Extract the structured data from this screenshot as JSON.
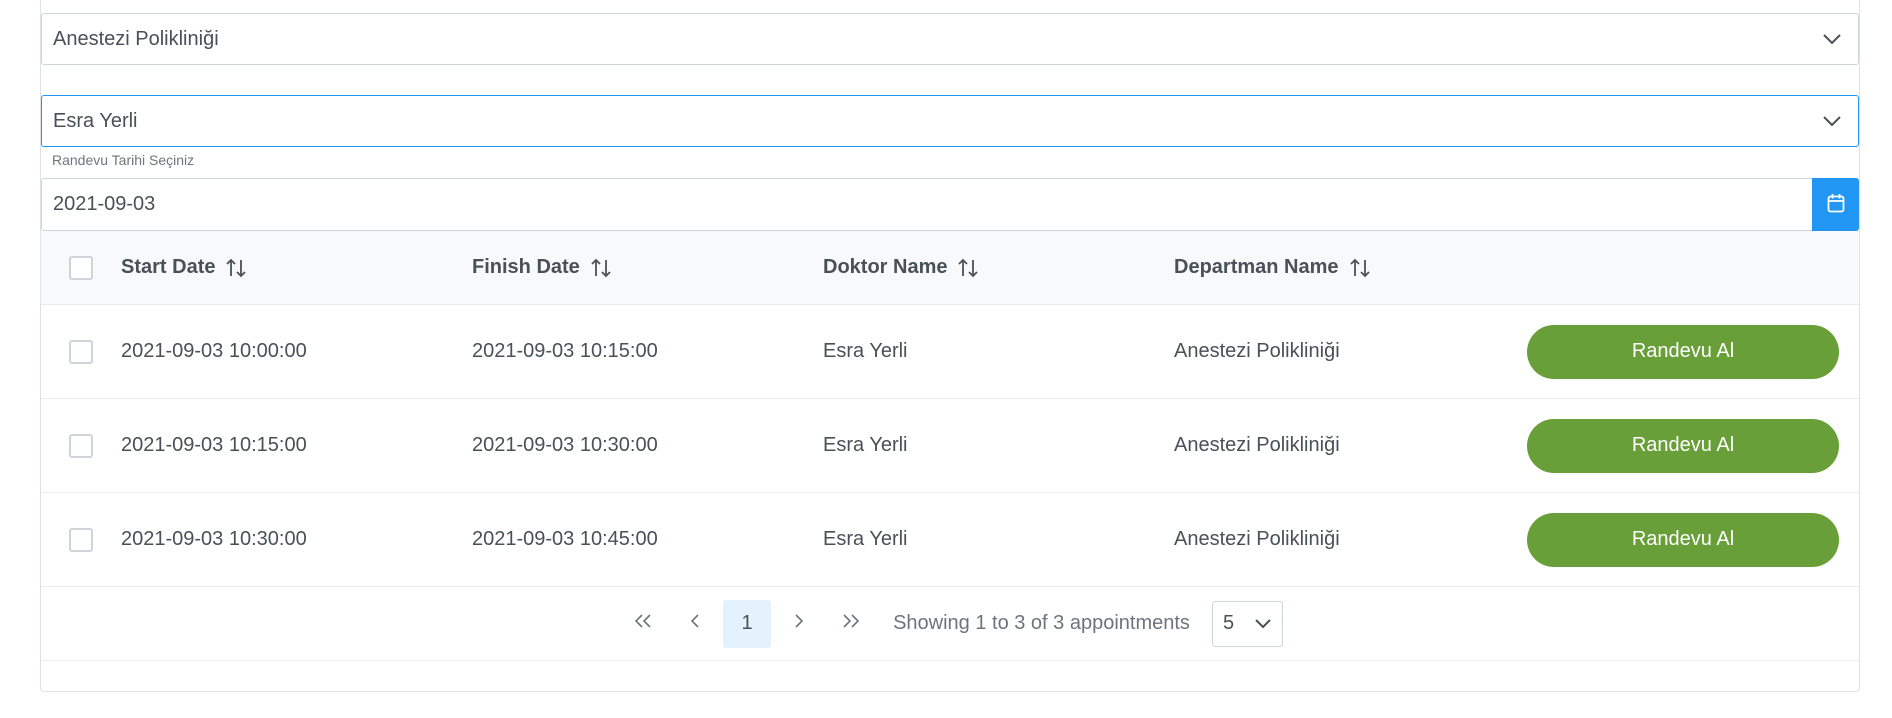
{
  "department_select": {
    "value": "Anestezi Polikliniği"
  },
  "doctor_select": {
    "value": "Esra Yerli"
  },
  "date_picker": {
    "label": "Randevu Tarihi Seçiniz",
    "value": "2021-09-03"
  },
  "table": {
    "columns": [
      "Start Date",
      "Finish Date",
      "Doktor Name",
      "Departman Name"
    ],
    "rows": [
      {
        "start": "2021-09-03 10:00:00",
        "finish": "2021-09-03 10:15:00",
        "doctor": "Esra Yerli",
        "department": "Anestezi Polikliniği",
        "action": "Randevu Al"
      },
      {
        "start": "2021-09-03 10:15:00",
        "finish": "2021-09-03 10:30:00",
        "doctor": "Esra Yerli",
        "department": "Anestezi Polikliniği",
        "action": "Randevu Al"
      },
      {
        "start": "2021-09-03 10:30:00",
        "finish": "2021-09-03 10:45:00",
        "doctor": "Esra Yerli",
        "department": "Anestezi Polikliniği",
        "action": "Randevu Al"
      }
    ]
  },
  "paginator": {
    "current_page": "1",
    "report": "Showing 1 to 3 of 3 appointments",
    "rows_per_page": "5"
  },
  "colors": {
    "accent": "#2196f3",
    "action_button": "#689f38",
    "page_highlight": "#e3f2fd"
  },
  "icons": {
    "dropdown": "chevron-down-icon",
    "calendar": "calendar-icon",
    "sort": "sort-icon",
    "first": "double-chevron-left-icon",
    "prev": "chevron-left-icon",
    "next": "chevron-right-icon",
    "last": "double-chevron-right-icon"
  }
}
